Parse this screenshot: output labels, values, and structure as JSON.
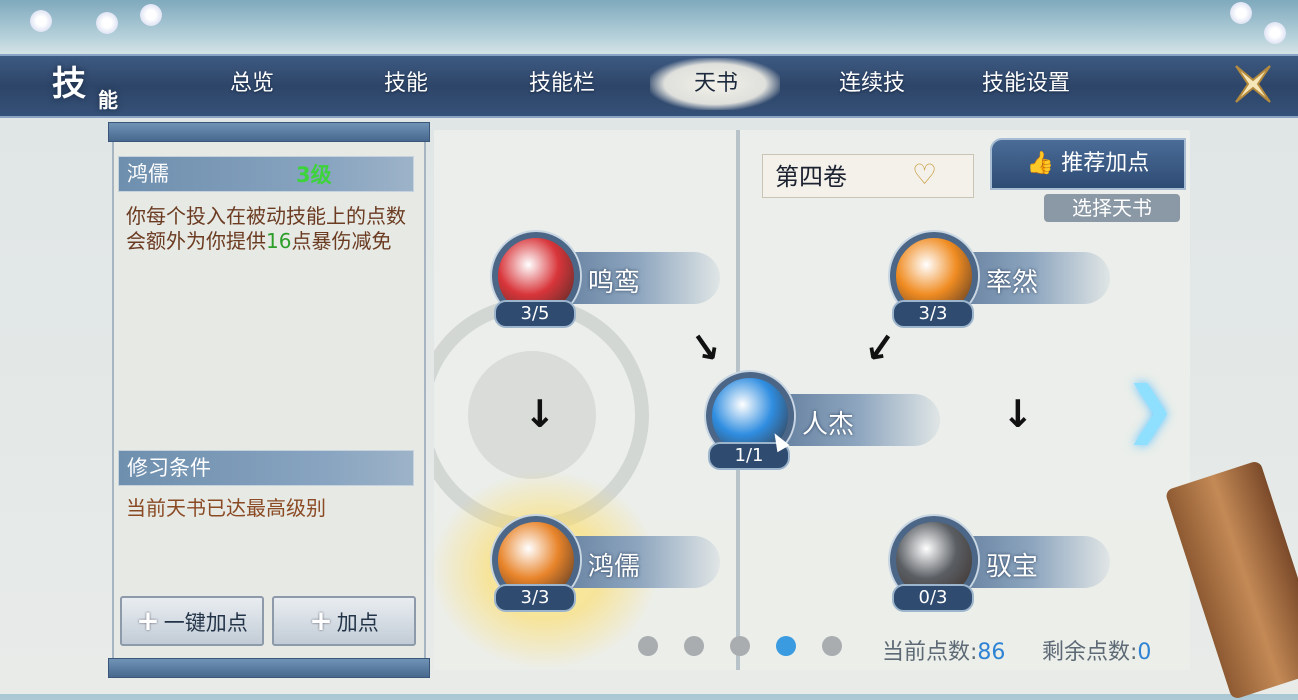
{
  "window": {
    "logo_main": "技",
    "logo_sub": "能"
  },
  "nav": {
    "tabs": [
      {
        "label": "总览"
      },
      {
        "label": "技能"
      },
      {
        "label": "技能栏"
      },
      {
        "label": "天书",
        "active": true
      },
      {
        "label": "连续技"
      },
      {
        "label": "技能设置"
      }
    ],
    "close_icon": "close-icon"
  },
  "detail": {
    "skill_name": "鸿儒",
    "skill_level": "3级",
    "desc_before": "你每个投入在被动技能上的点数会额外为你提供",
    "desc_value": "16",
    "desc_after": "点暴伤减免",
    "cond_title": "修习条件",
    "cond_text": "当前天书已达最高级别",
    "btn_auto": "一键加点",
    "btn_add": "加点"
  },
  "book": {
    "volume": "第四卷",
    "recommend": "推荐加点",
    "choose": "选择天书"
  },
  "skills": [
    {
      "name": "鸣鸾",
      "count": "3/5",
      "icon": "phoenix-icon",
      "color": "#d8353a"
    },
    {
      "name": "鸿儒",
      "count": "3/3",
      "icon": "shield-icon",
      "color": "#e8842a"
    },
    {
      "name": "人杰",
      "count": "1/1",
      "icon": "wave-icon",
      "color": "#2f8de0"
    },
    {
      "name": "率然",
      "count": "3/3",
      "icon": "snowflake-icon",
      "color": "#f08c22"
    },
    {
      "name": "驭宝",
      "count": "0/3",
      "icon": "mist-icon",
      "color": "#5a5e63"
    }
  ],
  "pager": {
    "total": 5,
    "active_index": 3
  },
  "points": {
    "current_label": "当前点数:",
    "current": "86",
    "remain_label": "剩余点数:",
    "remain": "0"
  },
  "colors": {
    "nav_bg": "#2d4568",
    "accent_green": "#3cd43a",
    "accent_blue": "#2f83d4",
    "desc_brown": "#6b3b22"
  }
}
